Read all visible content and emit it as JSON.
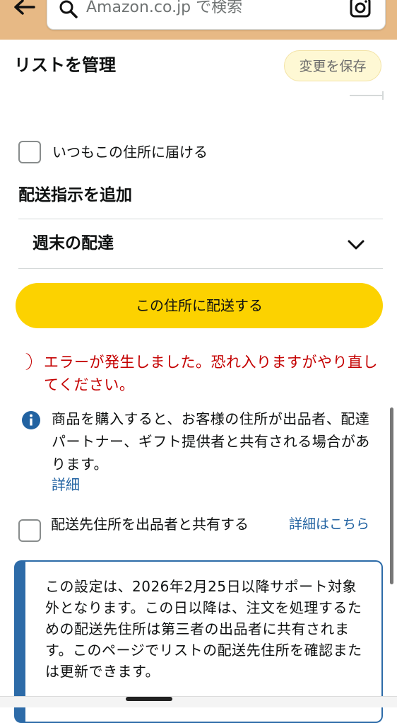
{
  "header": {
    "search_placeholder": "Amazon.co.jp で検索",
    "icons": {
      "back": "back-arrow-icon",
      "search": "search-icon",
      "camera": "camera-icon"
    },
    "bar_color": "#e7b985"
  },
  "title_bar": {
    "title": "リストを管理",
    "save_label": "変更を保存"
  },
  "address_options": {
    "always_deliver_label": "いつもこの住所に届ける",
    "always_deliver_checked": false
  },
  "delivery_instructions": {
    "title": "配送指示を追加",
    "dropdown_label": "週末の配達"
  },
  "primary_button": {
    "label": "この住所に配送する",
    "color": "#fcd200"
  },
  "error": {
    "message": "エラーが発生しました。恐れ入りますがやり直してください。",
    "color": "#c40000"
  },
  "info": {
    "message": "商品を購入すると、お客様の住所が出品者、配達パートナー、ギフト提供者と共有される場合があります。",
    "link_label": "詳細"
  },
  "share_option": {
    "label": "配送先住所を出品者と共有する",
    "link_label": "詳細はこちら",
    "checked": false
  },
  "notice": {
    "text": "この設定は、2026年2月25日以降サポート対象外となります。この日以降は、注文を処理するための配送先住所は第三者の出品者に共有されます。このページでリストの配送先住所を確認または更新できます。"
  }
}
